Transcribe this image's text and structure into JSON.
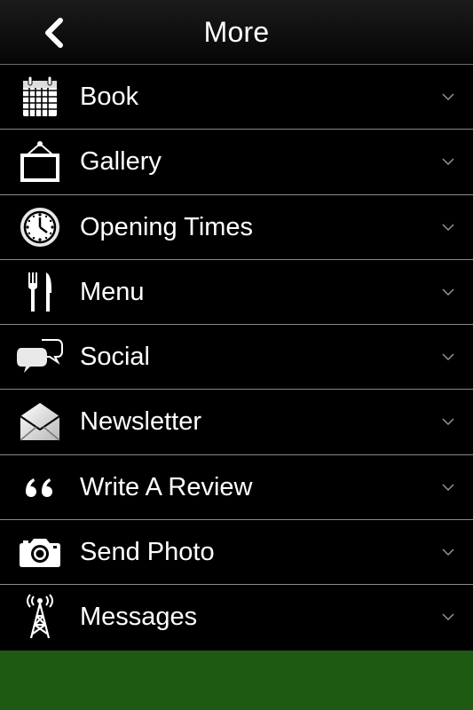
{
  "header": {
    "title": "More",
    "back_icon": "chevron-left-icon"
  },
  "menu": {
    "items": [
      {
        "label": "Book",
        "icon": "calendar-icon"
      },
      {
        "label": "Gallery",
        "icon": "picture-frame-icon"
      },
      {
        "label": "Opening Times",
        "icon": "clock-icon"
      },
      {
        "label": "Menu",
        "icon": "fork-knife-icon"
      },
      {
        "label": "Social",
        "icon": "speech-bubbles-icon"
      },
      {
        "label": "Newsletter",
        "icon": "envelope-icon"
      },
      {
        "label": "Write A Review",
        "icon": "quote-icon"
      },
      {
        "label": "Send Photo",
        "icon": "camera-icon"
      },
      {
        "label": "Messages",
        "icon": "antenna-icon"
      }
    ]
  },
  "colors": {
    "background": "#000000",
    "divider": "#8a8a8a",
    "footer": "#1f5a13",
    "text": "#ffffff"
  }
}
